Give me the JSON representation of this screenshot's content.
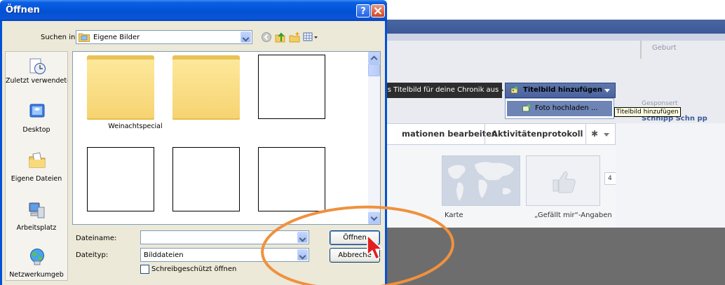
{
  "dialog": {
    "title": "Öffnen",
    "look_in_label": "Suchen in:",
    "look_in_value": "Eigene Bilder",
    "places": [
      {
        "label": "Zuletzt verwendete D..."
      },
      {
        "label": "Desktop"
      },
      {
        "label": "Eigene Dateien"
      },
      {
        "label": "Arbeitsplatz"
      },
      {
        "label": "Netzwerkumgeb"
      }
    ],
    "files": [
      {
        "type": "folder",
        "name": ""
      },
      {
        "type": "folder",
        "name": "Weinachtspecial"
      },
      {
        "type": "image",
        "name": ""
      },
      {
        "type": "image",
        "name": ""
      },
      {
        "type": "image",
        "name": ""
      },
      {
        "type": "image",
        "name": ""
      }
    ],
    "filename_label": "Dateiname:",
    "filename_value": "",
    "filetype_label": "Dateityp:",
    "filetype_value": "Bilddateien",
    "readonly_label": "Schreibgeschützt öffnen",
    "readonly_checked": false,
    "open_button": "Öffnen",
    "cancel_button": "Abbreche"
  },
  "facebook": {
    "birth_label": "Geburt",
    "cover_tooltip": "ls Titelbild für deine Chronik aus.",
    "cover_button": "Titelbild hinzufügen",
    "menu_upload": "Foto hochladen ...",
    "tooltip_cover": "Titelbild hinzufügen",
    "sponsored": "Gesponsert",
    "ad_name": "Schnipp Schn  pp",
    "nav_info": "mationen bearbeiten",
    "nav_activity": "Aktivitätenprotokoll",
    "count_badge": "4",
    "map_label": "Karte",
    "likes_label": "„Gefällt mir“-Angaben"
  },
  "colors": {
    "xp_title_blue": "#0351d4",
    "fb_blue": "#3b5998",
    "annotation_orange": "#f0913e"
  }
}
